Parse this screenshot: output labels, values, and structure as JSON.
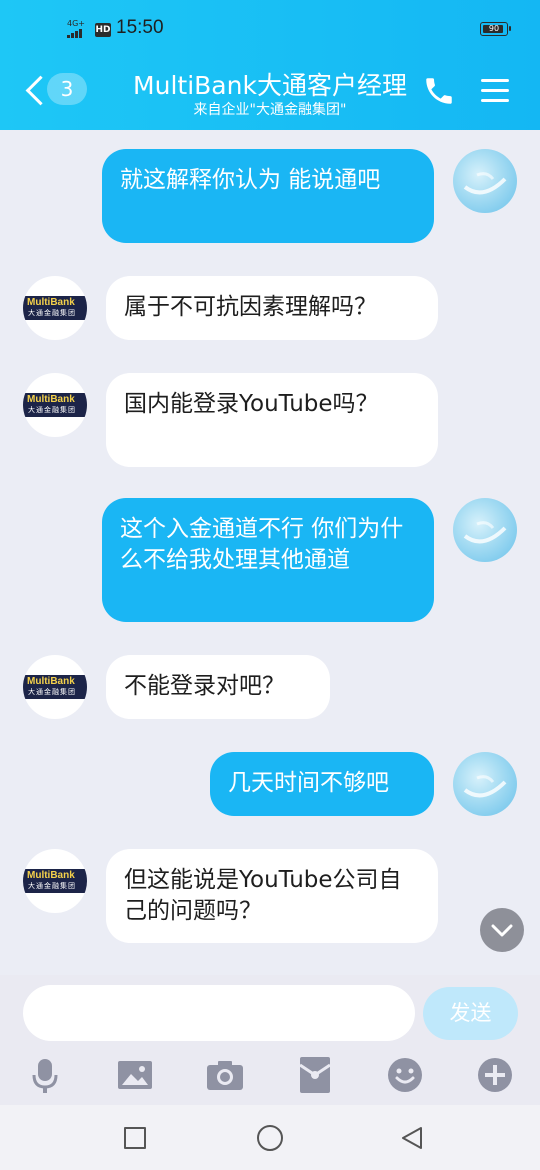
{
  "status_bar": {
    "signal_text": "4G+",
    "hd_label": "HD",
    "time": "15:50",
    "battery_level": 90,
    "battery_text": "90"
  },
  "header": {
    "unread_count": "3",
    "title": "MultiBank大通客户经理",
    "subtitle": "来自企业\"大通金融集团\""
  },
  "bank_logo": {
    "line1": "MultiBank",
    "line2": "大通金融集团"
  },
  "messages": [
    {
      "sender": "me",
      "text": "就这解释你认为   能说通吧"
    },
    {
      "sender": "agent",
      "text": "属于不可抗因素理解吗？"
    },
    {
      "sender": "agent",
      "text": "国内能登录YouTube吗？"
    },
    {
      "sender": "me",
      "text": "这个入金通道不行   你们为什么不给我处理其他通道"
    },
    {
      "sender": "agent",
      "text": "不能登录对吧？"
    },
    {
      "sender": "me",
      "text": "几天时间不够吧"
    },
    {
      "sender": "agent",
      "text": "但这能说是YouTube公司自己的问题吗？"
    }
  ],
  "input": {
    "value": "",
    "placeholder": "",
    "send_label": "发送"
  },
  "toolbar_icons": [
    "microphone-icon",
    "image-icon",
    "camera-icon",
    "red-packet-icon",
    "emoji-icon",
    "plus-icon"
  ],
  "colors": {
    "header": "#14b7f3",
    "my_bubble": "#1ab6f4",
    "their_bubble": "#ffffff",
    "background": "#ebedf5",
    "send_button": "#bfe8fb"
  }
}
